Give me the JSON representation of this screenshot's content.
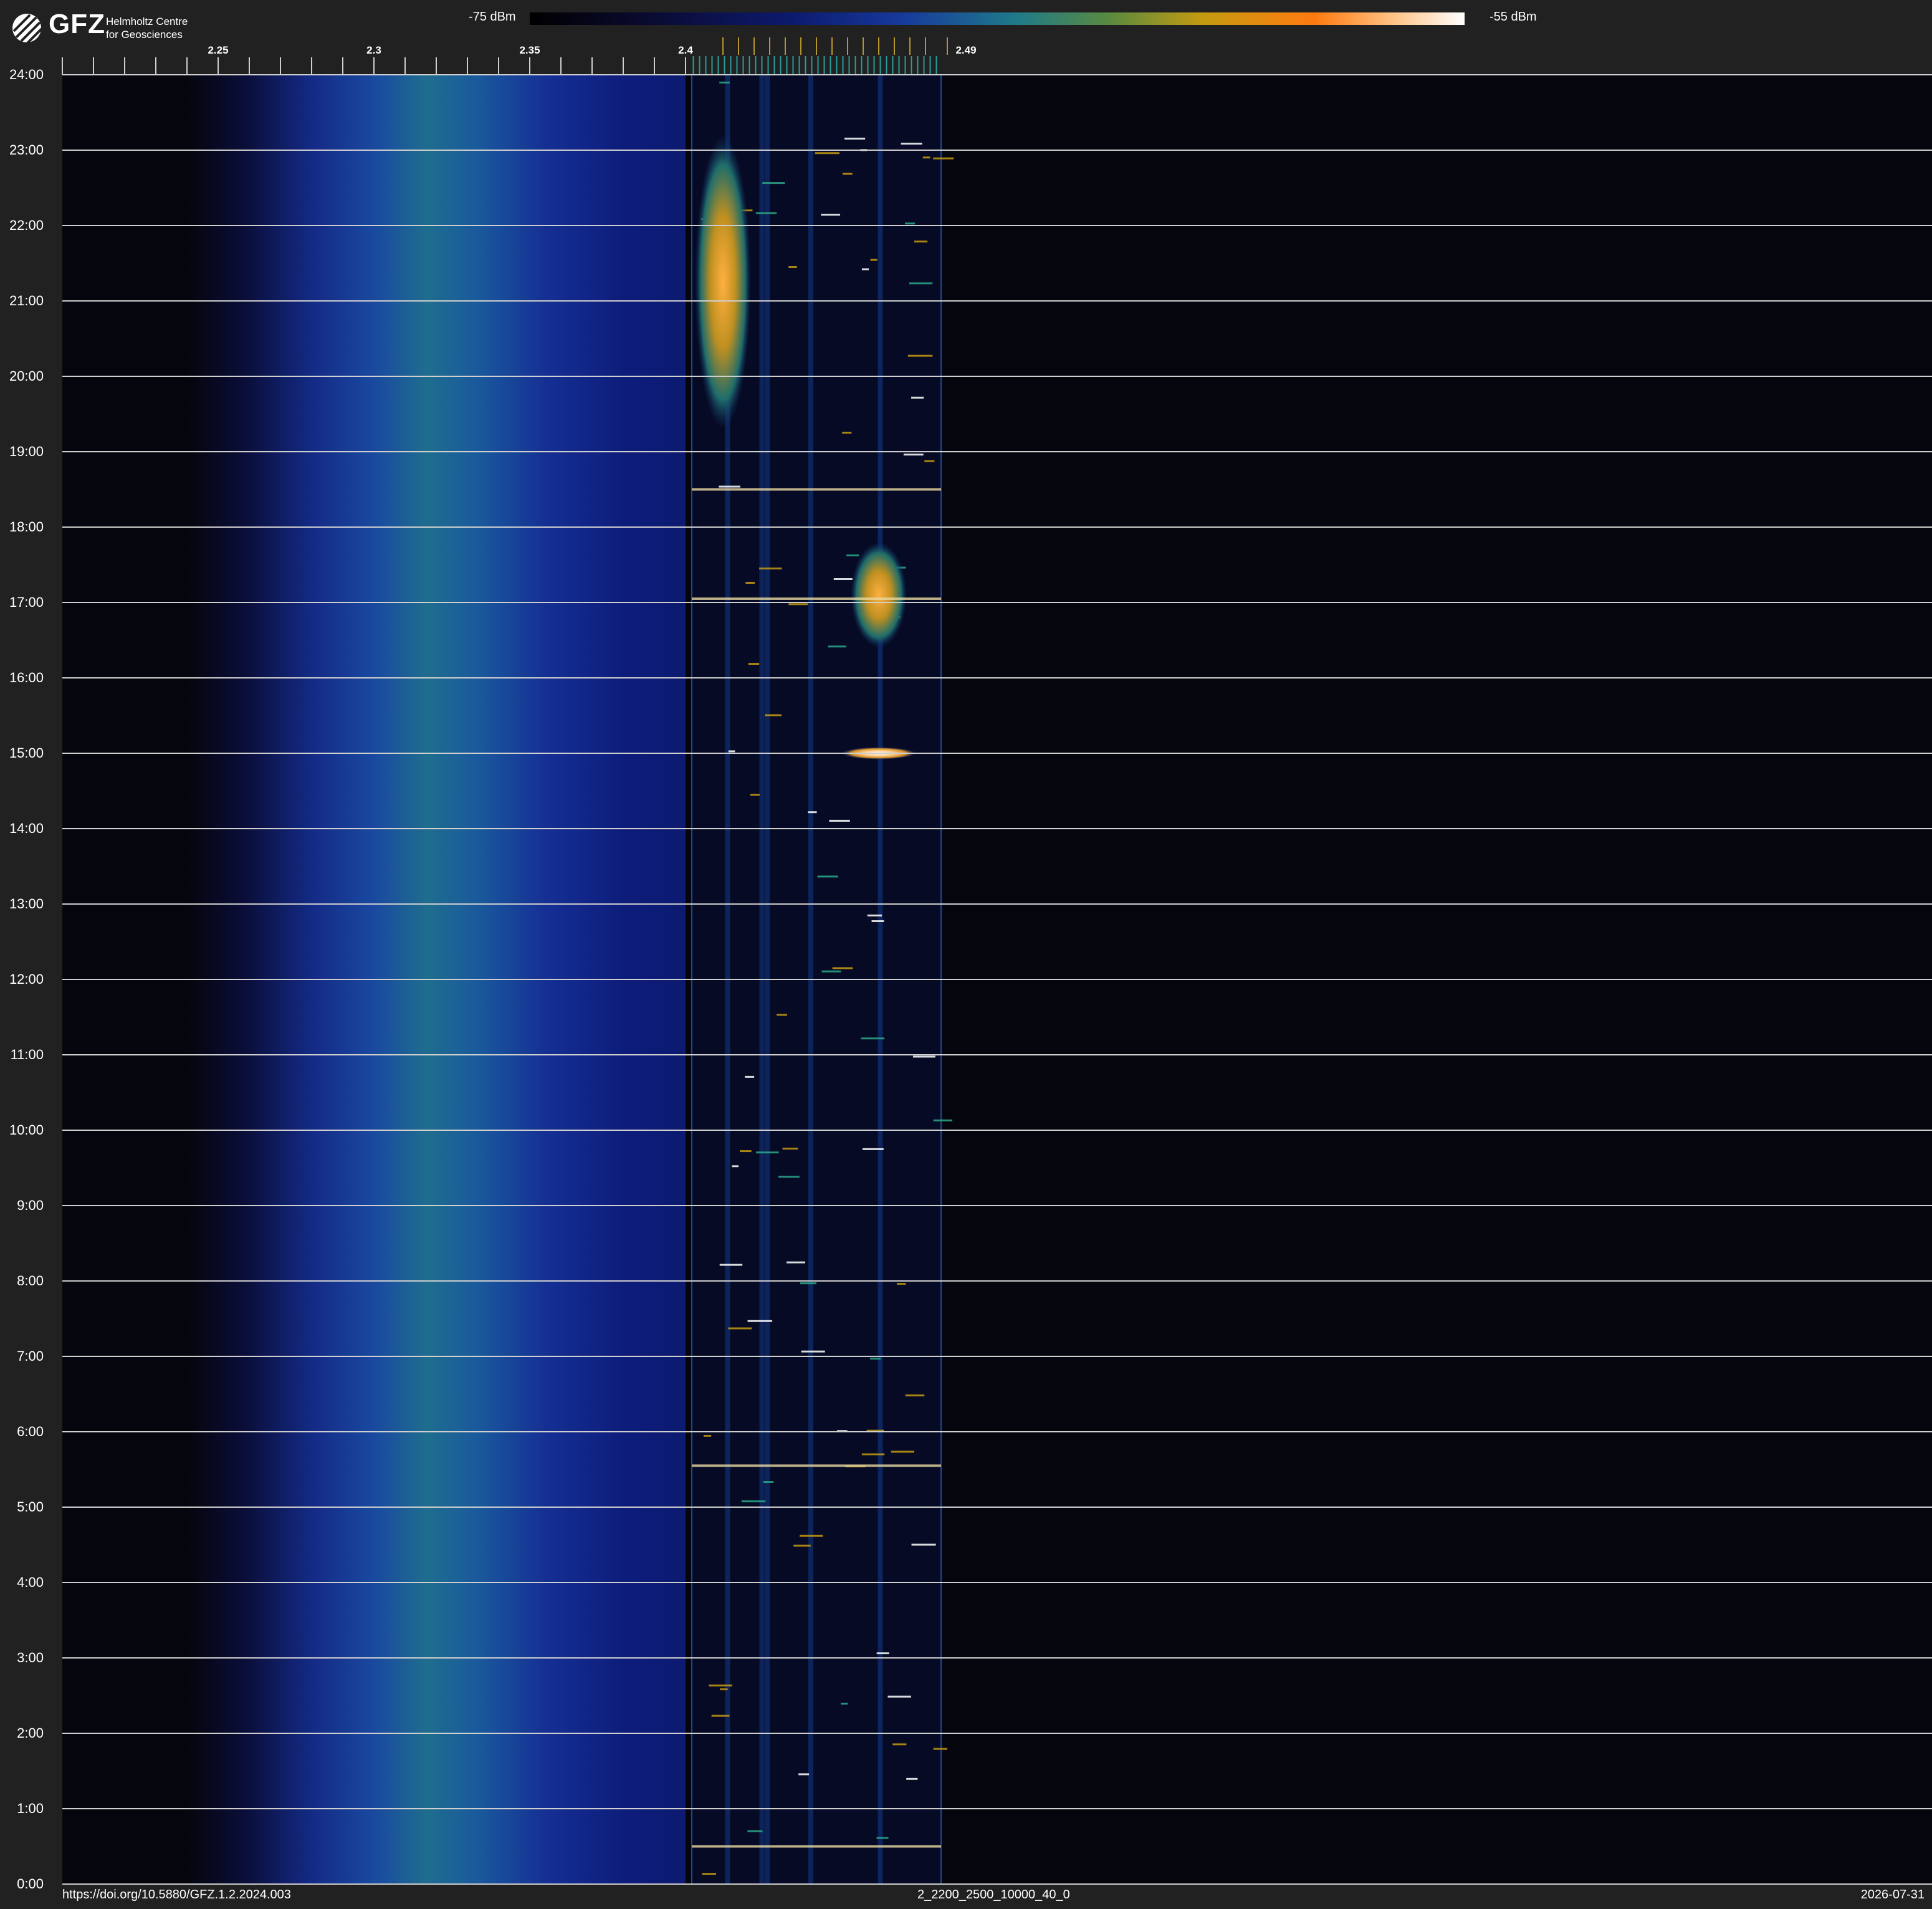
{
  "header": {
    "logo": {
      "wordmark": "GFZ",
      "subtitle_line1": "Helmholtz Centre",
      "subtitle_line2": "for Geosciences"
    },
    "colorbar": {
      "min_label": "-75 dBm",
      "max_label": "-55 dBm",
      "min_dbm": -75,
      "max_dbm": -55
    }
  },
  "footer": {
    "doi": "https://doi.org/10.5880/GFZ.1.2.2024.003",
    "file_id": "2_2200_2500_10000_40_0",
    "date": "2026-07-31"
  },
  "colors": {
    "background": "#212121",
    "plot_background": "#05050d",
    "gridline": "#cfcfcf",
    "channel_marker_teal": "#2a9d9a",
    "channel_marker_gold": "#b8962e"
  },
  "chart_data": {
    "type": "heatmap",
    "title": "",
    "xlabel": "",
    "ylabel": "",
    "x_unit": "GHz",
    "x_range": [
      2.2,
      2.49
    ],
    "x_tick_labels": [
      "2.25",
      "2.3",
      "2.35",
      "2.4",
      "2.49"
    ],
    "x_tick_values": [
      2.25,
      2.3,
      2.35,
      2.4,
      2.49
    ],
    "x_minor_ticks": [
      2.2,
      2.21,
      2.22,
      2.23,
      2.24,
      2.25,
      2.26,
      2.27,
      2.28,
      2.29,
      2.3,
      2.31,
      2.32,
      2.33,
      2.34,
      2.35,
      2.36,
      2.37,
      2.38,
      2.39,
      2.4
    ],
    "y_range_hours": [
      0,
      24
    ],
    "y_tick_labels": [
      "0:00",
      "1:00",
      "2:00",
      "3:00",
      "4:00",
      "5:00",
      "6:00",
      "7:00",
      "8:00",
      "9:00",
      "10:00",
      "11:00",
      "12:00",
      "13:00",
      "14:00",
      "15:00",
      "16:00",
      "17:00",
      "18:00",
      "19:00",
      "20:00",
      "21:00",
      "22:00",
      "23:00",
      "24:00"
    ],
    "y_tick_values": [
      0,
      1,
      2,
      3,
      4,
      5,
      6,
      7,
      8,
      9,
      10,
      11,
      12,
      13,
      14,
      15,
      16,
      17,
      18,
      19,
      20,
      21,
      22,
      23,
      24
    ],
    "color_scale_dbm": [
      -75,
      -55
    ],
    "broadband_noise_band_ghz": {
      "from": 2.31,
      "to": 2.4,
      "peak": 2.345
    },
    "wifi_band_ghz": {
      "from": 2.402,
      "to": 2.482
    },
    "channel_markers_teal_ghz": [
      2.4025,
      2.4045,
      2.4065,
      2.4085,
      2.4105,
      2.4125,
      2.4145,
      2.4165,
      2.4185,
      2.4205,
      2.4225,
      2.4245,
      2.4265,
      2.4285,
      2.4305,
      2.4325,
      2.4345,
      2.4365,
      2.4385,
      2.4405,
      2.4425,
      2.4445,
      2.4465,
      2.4485,
      2.4505,
      2.4525,
      2.4545,
      2.4565,
      2.4585,
      2.4605,
      2.4625,
      2.4645,
      2.4665,
      2.4685,
      2.4705,
      2.4725,
      2.4745,
      2.4765,
      2.4785,
      2.4805
    ],
    "channel_markers_gold_ghz": [
      2.412,
      2.417,
      2.422,
      2.427,
      2.432,
      2.437,
      2.442,
      2.447,
      2.452,
      2.457,
      2.462,
      2.467,
      2.472,
      2.477,
      2.484
    ],
    "hotspots": [
      {
        "f_ghz": 2.412,
        "t_from": 19.3,
        "t_to": 23.2,
        "level_dbm": -60
      },
      {
        "f_ghz": 2.462,
        "t_from": 16.4,
        "t_to": 17.8,
        "level_dbm": -61
      },
      {
        "f_ghz": 2.462,
        "t_from": 14.95,
        "t_to": 15.05,
        "level_dbm": -56
      }
    ],
    "broadband_bursts_hours": [
      0.5,
      5.55,
      17.05,
      18.5
    ],
    "legend": "none"
  }
}
